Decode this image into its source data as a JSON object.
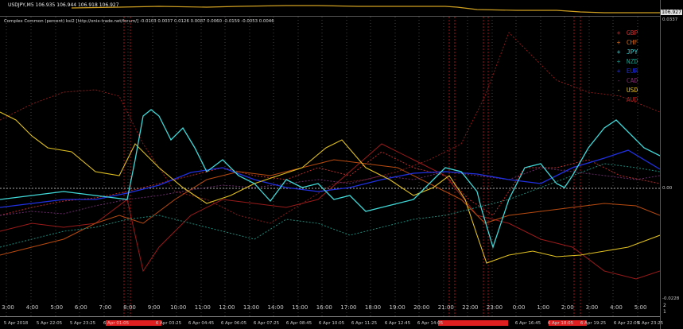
{
  "price_pane": {
    "title": "USDJPY,M5  106.935 106.944 106.918 106.927",
    "last_price": "106.927"
  },
  "indicator": {
    "title": "Complex Common (percent) ksi2 [http://onix-trade.net/forum/] -0.0103 0.0037 0.0126 0.0087 0.0060 -0.0159 -0.0053 0.0046",
    "scale": {
      "top": "0.0337",
      "zero": "0.00",
      "bottom": "-0.0228"
    },
    "pane_numbers": [
      "2",
      "1"
    ]
  },
  "legend": [
    {
      "mark": "+",
      "label": "GBP",
      "color": "#c83030"
    },
    {
      "mark": "+",
      "label": "CHF",
      "color": "#d86a1a"
    },
    {
      "mark": "+",
      "label": "JPY",
      "color": "#40d8d8"
    },
    {
      "mark": "+",
      "label": "NZD",
      "color": "#1a9a8a"
    },
    {
      "mark": "+",
      "label": "EUR",
      "color": "#2030e0"
    },
    {
      "mark": "-",
      "label": "CAD",
      "color": "#7a2a6a"
    },
    {
      "mark": "-",
      "label": "USD",
      "color": "#e0c020"
    },
    {
      "mark": "-",
      "label": "AUD",
      "color": "#a02020"
    }
  ],
  "time_axis": {
    "hours": [
      "3:00",
      "4:00",
      "5:00",
      "6:00",
      "7:00",
      "8:00",
      "9:00",
      "10:00",
      "11:00",
      "12:00",
      "13:00",
      "14:00",
      "15:00",
      "16:00",
      "17:00",
      "18:00",
      "19:00",
      "20:00",
      "21:00",
      "22:00",
      "23:00",
      "0:00",
      "1:00",
      "2:00",
      "3:00",
      "4:00",
      "5:00"
    ],
    "dates": [
      "5 Apr 2018",
      "5 Apr 22:05",
      "5 Apr 23:25",
      "6 Apr 01:05",
      "6 Apr 03:25",
      "6 Apr 04:45",
      "6 Apr 06:05",
      "6 Apr 07:25",
      "6 Apr 08:45",
      "6 Apr 10:05",
      "6 Apr 11:25",
      "6 Apr 12:45",
      "6 Apr 14:05",
      "6 Apr 16:45",
      "6 Apr 18:05",
      "6 Apr 19:25",
      "6 Apr 22:05",
      "6 Apr 23:25"
    ]
  },
  "colors": {
    "GBP": "#c83030",
    "CHF": "#d86a1a",
    "JPY": "#40d8d8",
    "NZD": "#1a9a8a",
    "EUR": "#2030e0",
    "CAD": "#7a2a6a",
    "USD": "#e0c020",
    "AUD": "#a02020"
  }
}
